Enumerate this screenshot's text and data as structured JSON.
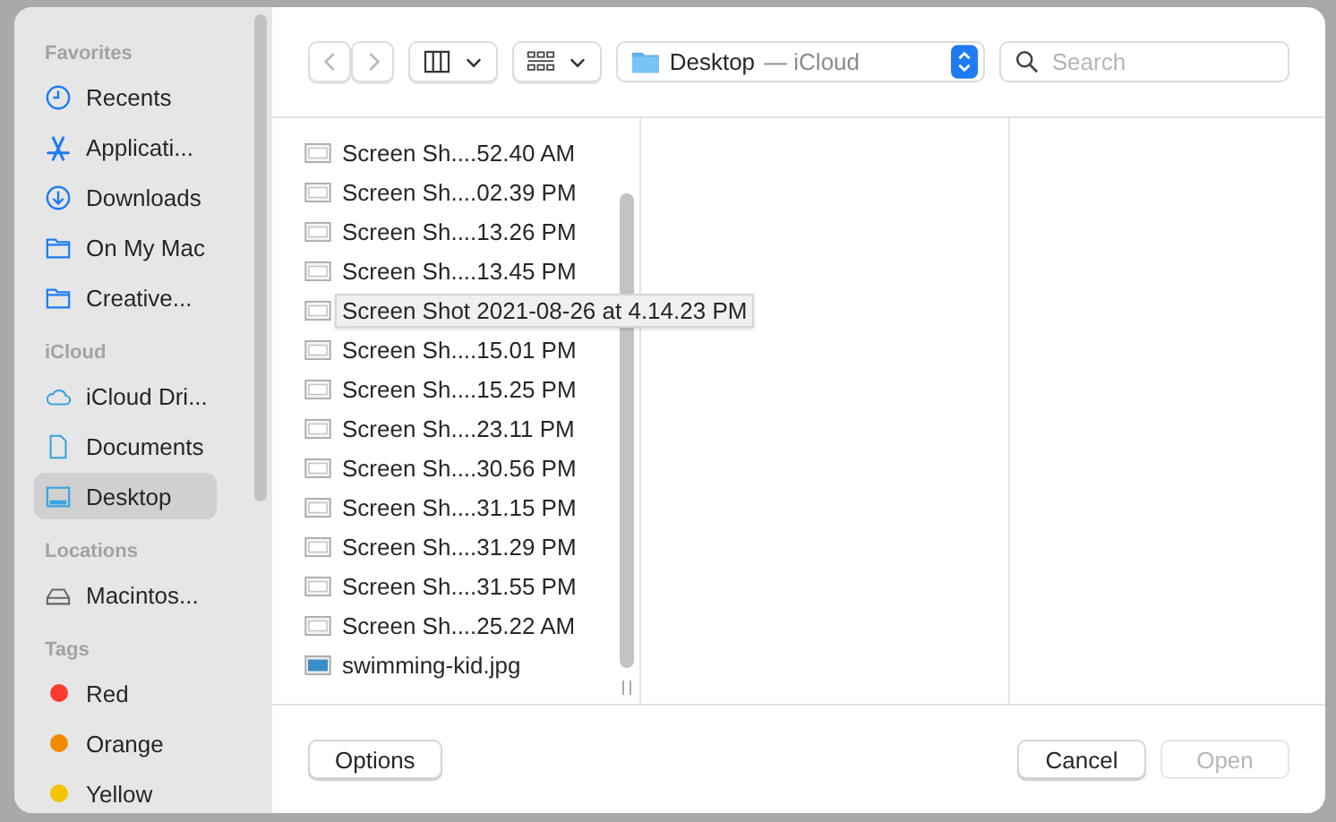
{
  "sidebar": {
    "sections": [
      {
        "title": "Favorites",
        "items": [
          {
            "label": "Recents",
            "kind": "clock",
            "selected": false
          },
          {
            "label": "Applicati...",
            "kind": "apps",
            "selected": false
          },
          {
            "label": "Downloads",
            "kind": "download",
            "selected": false
          },
          {
            "label": "On My Mac",
            "kind": "folder",
            "selected": false
          },
          {
            "label": "Creative...",
            "kind": "folder",
            "selected": false
          }
        ]
      },
      {
        "title": "iCloud",
        "items": [
          {
            "label": "iCloud Dri...",
            "kind": "cloud",
            "selected": false
          },
          {
            "label": "Documents",
            "kind": "document",
            "selected": false
          },
          {
            "label": "Desktop",
            "kind": "desktop",
            "selected": true
          }
        ]
      },
      {
        "title": "Locations",
        "items": [
          {
            "label": "Macintos...",
            "kind": "disk",
            "selected": false
          }
        ]
      },
      {
        "title": "Tags",
        "items": [
          {
            "label": "Red",
            "kind": "tag",
            "color": "#ff3b30",
            "selected": false
          },
          {
            "label": "Orange",
            "kind": "tag",
            "color": "#f08a00",
            "selected": false
          },
          {
            "label": "Yellow",
            "kind": "tag",
            "color": "#f5c400",
            "selected": false
          }
        ]
      }
    ]
  },
  "toolbar": {
    "location": "Desktop",
    "location_suffix": "— iCloud",
    "search": {
      "placeholder": "Search"
    }
  },
  "files": [
    {
      "name": "Screen Sh....52.40 AM",
      "kind": "screenshot",
      "hovered": false
    },
    {
      "name": "Screen Sh....02.39 PM",
      "kind": "screenshot",
      "hovered": false
    },
    {
      "name": "Screen Sh....13.26 PM",
      "kind": "screenshot",
      "hovered": false
    },
    {
      "name": "Screen Sh....13.45 PM",
      "kind": "screenshot",
      "hovered": false
    },
    {
      "name": "Screen Shot 2021-08-26 at 4.14.23 PM",
      "kind": "screenshot",
      "hovered": true
    },
    {
      "name": "Screen Sh....15.01 PM",
      "kind": "screenshot",
      "hovered": false
    },
    {
      "name": "Screen Sh....15.25 PM",
      "kind": "screenshot",
      "hovered": false
    },
    {
      "name": "Screen Sh....23.11 PM",
      "kind": "screenshot",
      "hovered": false
    },
    {
      "name": "Screen Sh....30.56 PM",
      "kind": "screenshot",
      "hovered": false
    },
    {
      "name": "Screen Sh....31.15 PM",
      "kind": "screenshot",
      "hovered": false
    },
    {
      "name": "Screen Sh....31.29 PM",
      "kind": "screenshot",
      "hovered": false
    },
    {
      "name": "Screen Sh....31.55 PM",
      "kind": "screenshot",
      "hovered": false
    },
    {
      "name": "Screen Sh....25.22 AM",
      "kind": "screenshot",
      "hovered": false
    },
    {
      "name": "swimming-kid.jpg",
      "kind": "image",
      "hovered": false
    }
  ],
  "buttons": [
    {
      "label": "Options",
      "disabled": false
    },
    {
      "label": "Cancel",
      "disabled": false
    },
    {
      "label": "Open",
      "disabled": true
    }
  ]
}
